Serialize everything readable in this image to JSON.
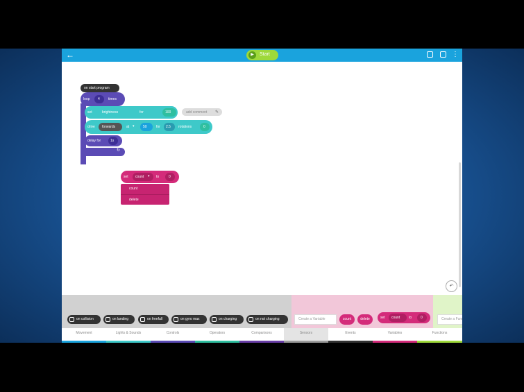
{
  "header": {
    "back_icon": "arrow-left-icon",
    "start_label": "Start",
    "icons": [
      "device-icon",
      "save-icon",
      "more-icon"
    ]
  },
  "canvas": {
    "on_start": "on start program",
    "loop_label": "loop",
    "loop_count": "4",
    "loop_unit": "times",
    "set_label": "set",
    "set_param": "brightness",
    "set_for_label": "for",
    "set_value": "100",
    "comment_placeholder": "add comment",
    "drive_label": "drive",
    "drive_direction": "forwards",
    "drive_at_label": "at",
    "drive_speed": "50",
    "drive_for_label": "for",
    "drive_distance": "2.5",
    "drive_unit": "rotations",
    "drive_end": "0",
    "delay_label": "delay for",
    "delay_value": "1s",
    "loose_label": "set",
    "loose_var": "count",
    "loose_to": "to",
    "loose_value": "0",
    "dropdown_options": [
      "count",
      "delete"
    ]
  },
  "palette": {
    "events": [
      "on collision",
      "on landing",
      "on freefall",
      "on gyro max",
      "on charging",
      "on not charging"
    ],
    "create_variable": "Create a Variable",
    "pink_buttons": [
      "count",
      "delete"
    ],
    "palette_block_label": "set",
    "palette_block_var": "count",
    "palette_block_to": "to",
    "palette_block_value": "0",
    "create_function": "Create a Function"
  },
  "tabs": [
    {
      "label": "Movement",
      "color": "#1aa3dd"
    },
    {
      "label": "Lights & Sounds",
      "color": "#3ec9c9"
    },
    {
      "label": "Controls",
      "color": "#5b4bb5"
    },
    {
      "label": "Operators",
      "color": "#2fbfa0"
    },
    {
      "label": "Comparisons",
      "color": "#6a3fa8"
    },
    {
      "label": "Sensors",
      "color": "#9a9a9a"
    },
    {
      "label": "Events",
      "color": "#333333"
    },
    {
      "label": "Variables",
      "color": "#d42b7a"
    },
    {
      "label": "Functions",
      "color": "#9ed93a"
    }
  ]
}
